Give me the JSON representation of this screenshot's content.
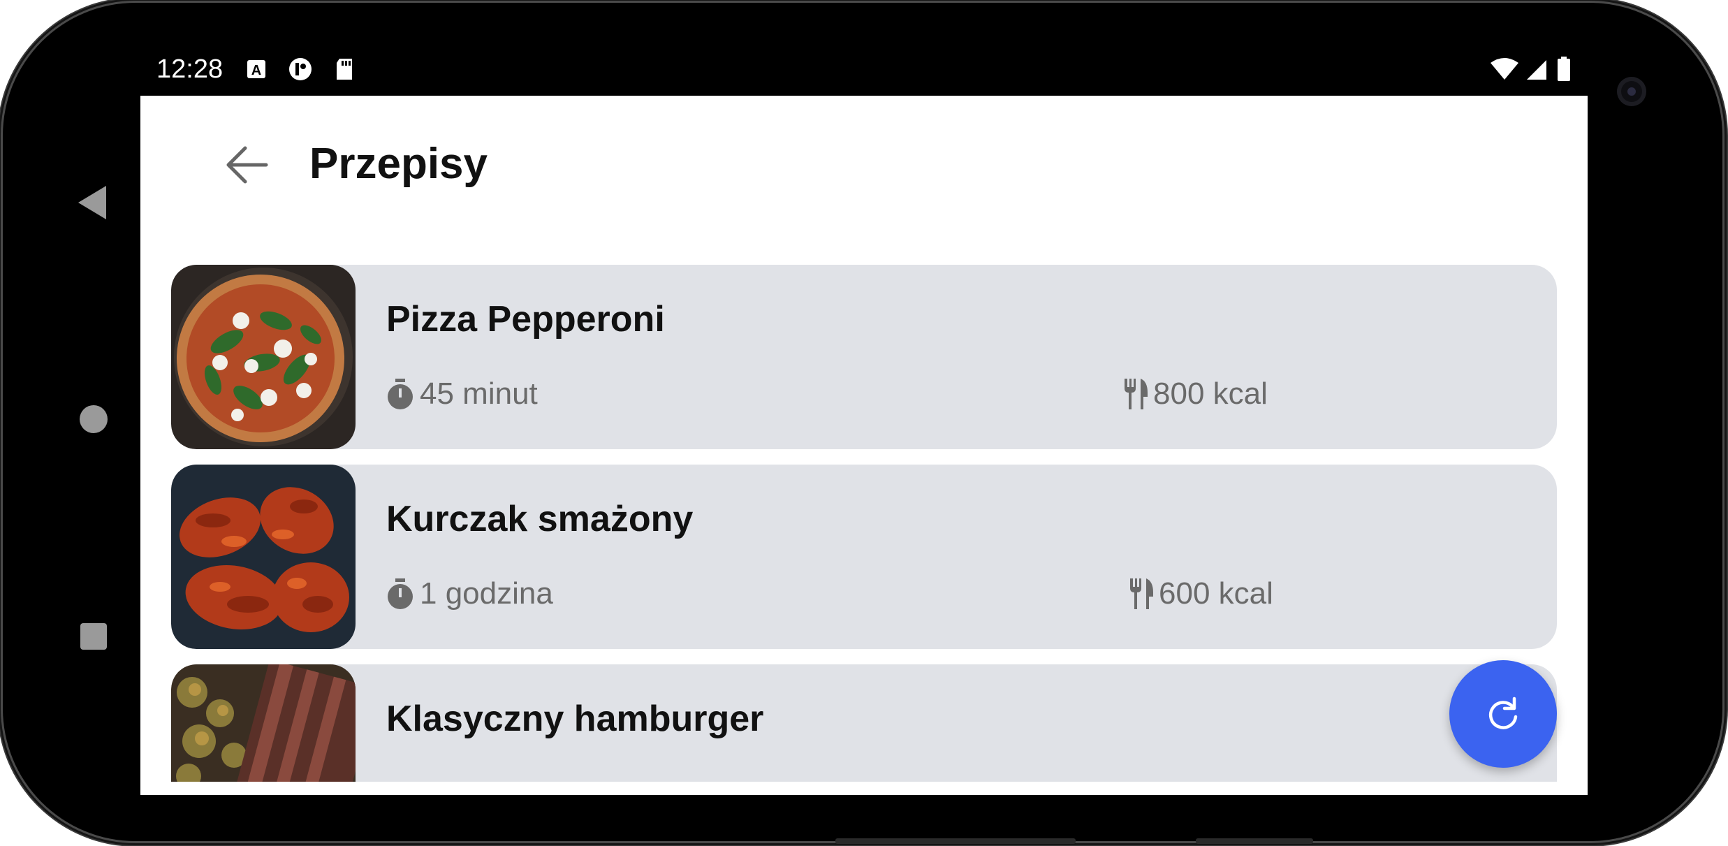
{
  "status_bar": {
    "time": "12:28",
    "left_icons": [
      "a-badge-icon",
      "account-icon",
      "sd-card-icon"
    ],
    "right_icons": [
      "wifi-icon",
      "signal-icon",
      "battery-icon"
    ]
  },
  "header": {
    "title": "Przepisy",
    "back_icon": "arrow-back-icon"
  },
  "recipes": [
    {
      "name": "Pizza Pepperoni",
      "time": "45 minut",
      "calories": "800 kcal",
      "image": "pizza"
    },
    {
      "name": "Kurczak smażony",
      "time": "1 godzina",
      "calories": "600 kcal",
      "image": "fried-chicken"
    },
    {
      "name": "Klasyczny hamburger",
      "image": "steak-potatoes"
    }
  ],
  "fab": {
    "icon": "refresh-icon"
  },
  "colors": {
    "card_background": "#e0e2e7",
    "fab": "#3b63f0",
    "meta_text": "#6a6a6a"
  }
}
